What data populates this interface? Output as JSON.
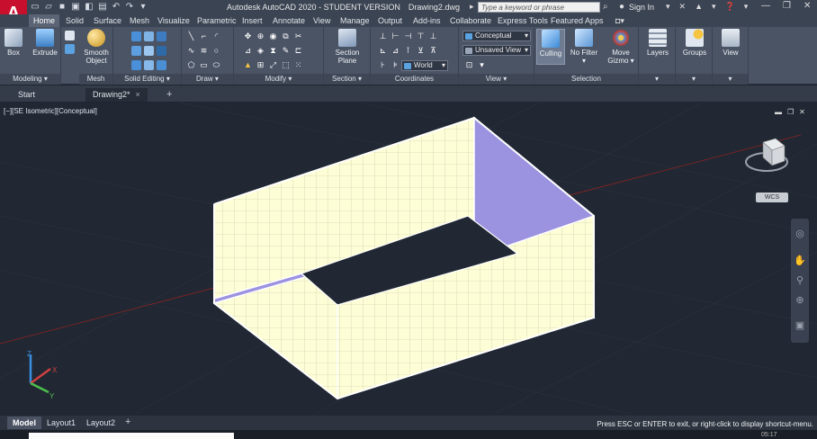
{
  "app": {
    "logo": "A",
    "title": "Autodesk AutoCAD 2020 - STUDENT VERSION",
    "document": "Drawing2.dwg",
    "search_placeholder": "Type a keyword or phrase",
    "signin": "Sign In"
  },
  "ribbon_tabs": [
    "Home",
    "Solid",
    "Surface",
    "Mesh",
    "Visualize",
    "Parametric",
    "Insert",
    "Annotate",
    "View",
    "Manage",
    "Output",
    "Add-ins",
    "Collaborate",
    "Express Tools",
    "Featured Apps"
  ],
  "ribbon": {
    "modeling": {
      "label": "Modeling",
      "box": "Box",
      "extrude": "Extrude"
    },
    "mesh": {
      "label": "Mesh",
      "smooth_object_1": "Smooth",
      "smooth_object_2": "Object"
    },
    "solid_editing": {
      "label": "Solid Editing"
    },
    "draw": {
      "label": "Draw"
    },
    "modify": {
      "label": "Modify"
    },
    "section": {
      "label": "Section",
      "plane_1": "Section",
      "plane_2": "Plane"
    },
    "coordinates": {
      "label": "Coordinates",
      "world": "World"
    },
    "view": {
      "label": "View",
      "visual_style": "Conceptual",
      "named_view": "Unsaved View"
    },
    "selection": {
      "label": "Selection",
      "culling": "Culling",
      "no_filter": "No Filter",
      "move_gizmo_1": "Move",
      "move_gizmo_2": "Gizmo"
    },
    "layers": {
      "label": "Layers"
    },
    "groups": {
      "label": "Groups"
    },
    "view_panel": {
      "label": "View"
    }
  },
  "file_tabs": {
    "start": "Start",
    "drawing": "Drawing2*",
    "close": "×",
    "add": "+"
  },
  "viewport": {
    "label": "[−][SE Isometric][Conceptual]",
    "wcs": "WCS"
  },
  "layout_tabs": [
    "Model",
    "Layout1",
    "Layout2"
  ],
  "layout_add": "+",
  "command_prompt": "Press ESC or ENTER to exit, or right-click to display shortcut-menu.",
  "clock": "05:17",
  "colors": {
    "wall_light": "#fdfdd6",
    "wall_shaded": "#9b93e0",
    "grid_line": "#b8b89a",
    "axis_red": "#8f2222",
    "ribbon": "#4b5465",
    "logo": "#c8102e"
  }
}
